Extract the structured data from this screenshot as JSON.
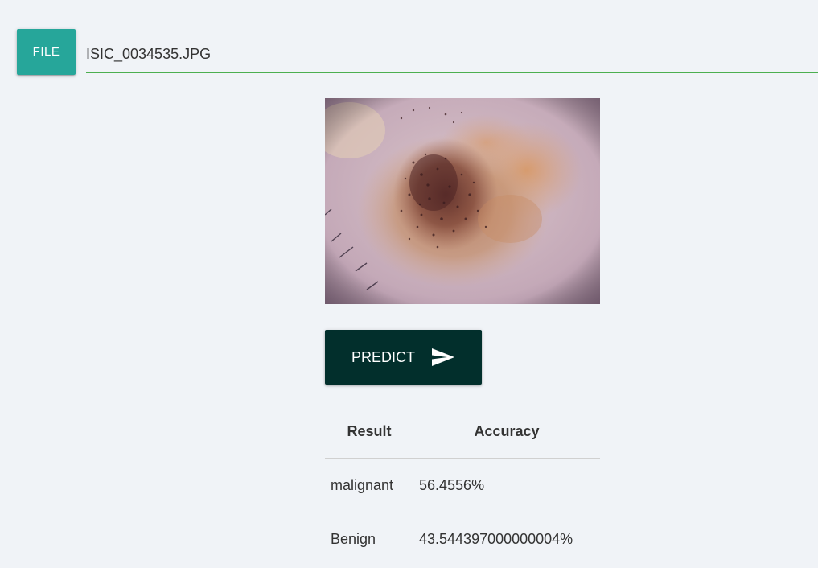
{
  "file_input": {
    "button_label": "FILE",
    "file_name": "ISIC_0034535.JPG"
  },
  "image": {
    "subject": "dermoscopy skin lesion"
  },
  "predict_button": {
    "label": "PREDICT",
    "icon": "send-icon"
  },
  "results_table": {
    "headers": [
      "Result",
      "Accuracy"
    ],
    "rows": [
      [
        "malignant",
        "56.4556%"
      ],
      [
        "Benign",
        "43.544397000000004%"
      ]
    ]
  },
  "colors": {
    "background": "#f0f3f7",
    "file_button": "#26a69a",
    "input_underline": "#4caf50",
    "predict_button": "#022f2c"
  }
}
